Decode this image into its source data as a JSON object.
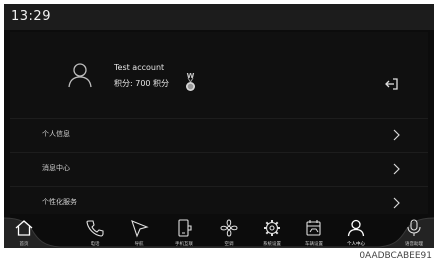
{
  "status": {
    "time": "13:29"
  },
  "account": {
    "name": "Test account",
    "points": "积分: 700 积分",
    "medal_mark": "W",
    "avatar_icon": "person-outline-icon",
    "medal_icon": "medal-icon",
    "logout_icon": "logout-icon"
  },
  "menu": {
    "items": [
      {
        "label": "个人信息",
        "icon": "chevron-right-icon"
      },
      {
        "label": "消息中心",
        "icon": "chevron-right-icon"
      },
      {
        "label": "个性化服务",
        "icon": "chevron-right-icon"
      }
    ]
  },
  "dock": {
    "items": [
      {
        "label": "首页",
        "icon": "home-icon"
      },
      {
        "label": "电话",
        "icon": "phone-icon"
      },
      {
        "label": "导航",
        "icon": "navigation-icon"
      },
      {
        "label": "手机互联",
        "icon": "phone-link-icon"
      },
      {
        "label": "空调",
        "icon": "fan-icon"
      },
      {
        "label": "系统设置",
        "icon": "gear-icon"
      },
      {
        "label": "车辆设置",
        "icon": "vehicle-settings-icon"
      },
      {
        "label": "个人中心",
        "icon": "person-icon",
        "active": true
      },
      {
        "label": "语音助理",
        "icon": "microphone-icon"
      }
    ]
  },
  "footer": {
    "code": "0AADBCABEE91"
  },
  "colors": {
    "background": "#0c0c0c",
    "status_bar": "#1c1c1c",
    "text": "#e6e6e6",
    "accent": "#ffffff"
  }
}
